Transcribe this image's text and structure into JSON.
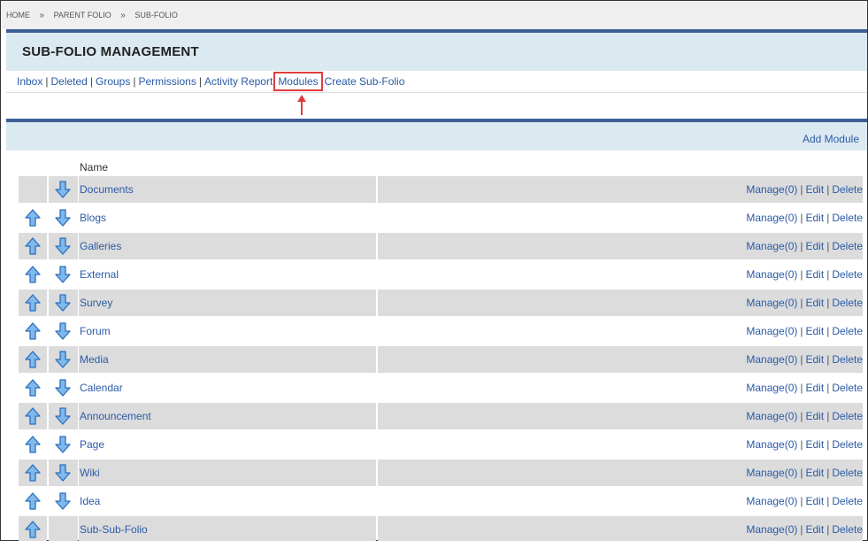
{
  "breadcrumb": {
    "home": "HOME",
    "sep": "»",
    "parent": "PARENT FOLIO",
    "current": "SUB-FOLIO"
  },
  "page_title": "SUB-FOLIO MANAGEMENT",
  "nav": {
    "inbox": "Inbox",
    "deleted": "Deleted",
    "groups": "Groups",
    "permissions": "Permissions",
    "activity_report": "Activity Report",
    "modules": "Modules",
    "create_sub_folio": "Create Sub-Folio",
    "pipe": "|"
  },
  "module_panel": {
    "add_module": "Add Module",
    "name_header": "Name"
  },
  "actions": {
    "manage": "Manage(0)",
    "edit": "Edit",
    "delete": "Delete",
    "pipe": "|"
  },
  "modules": [
    {
      "name": "Documents",
      "up": false,
      "down": true
    },
    {
      "name": "Blogs",
      "up": true,
      "down": true
    },
    {
      "name": "Galleries",
      "up": true,
      "down": true
    },
    {
      "name": "External",
      "up": true,
      "down": true
    },
    {
      "name": "Survey",
      "up": true,
      "down": true
    },
    {
      "name": "Forum",
      "up": true,
      "down": true
    },
    {
      "name": "Media",
      "up": true,
      "down": true
    },
    {
      "name": "Calendar",
      "up": true,
      "down": true
    },
    {
      "name": "Announcement",
      "up": true,
      "down": true
    },
    {
      "name": "Page",
      "up": true,
      "down": true
    },
    {
      "name": "Wiki",
      "up": true,
      "down": true
    },
    {
      "name": "Idea",
      "up": true,
      "down": true
    },
    {
      "name": "Sub-Sub-Folio",
      "up": true,
      "down": false
    }
  ],
  "colors": {
    "accent": "#3d5d96",
    "panel": "#dbe9f1",
    "link": "#2b5ba6",
    "highlight": "#e03c3c",
    "row_shade": "#dcdcdc",
    "arrow_fill": "#7fb8ea"
  }
}
